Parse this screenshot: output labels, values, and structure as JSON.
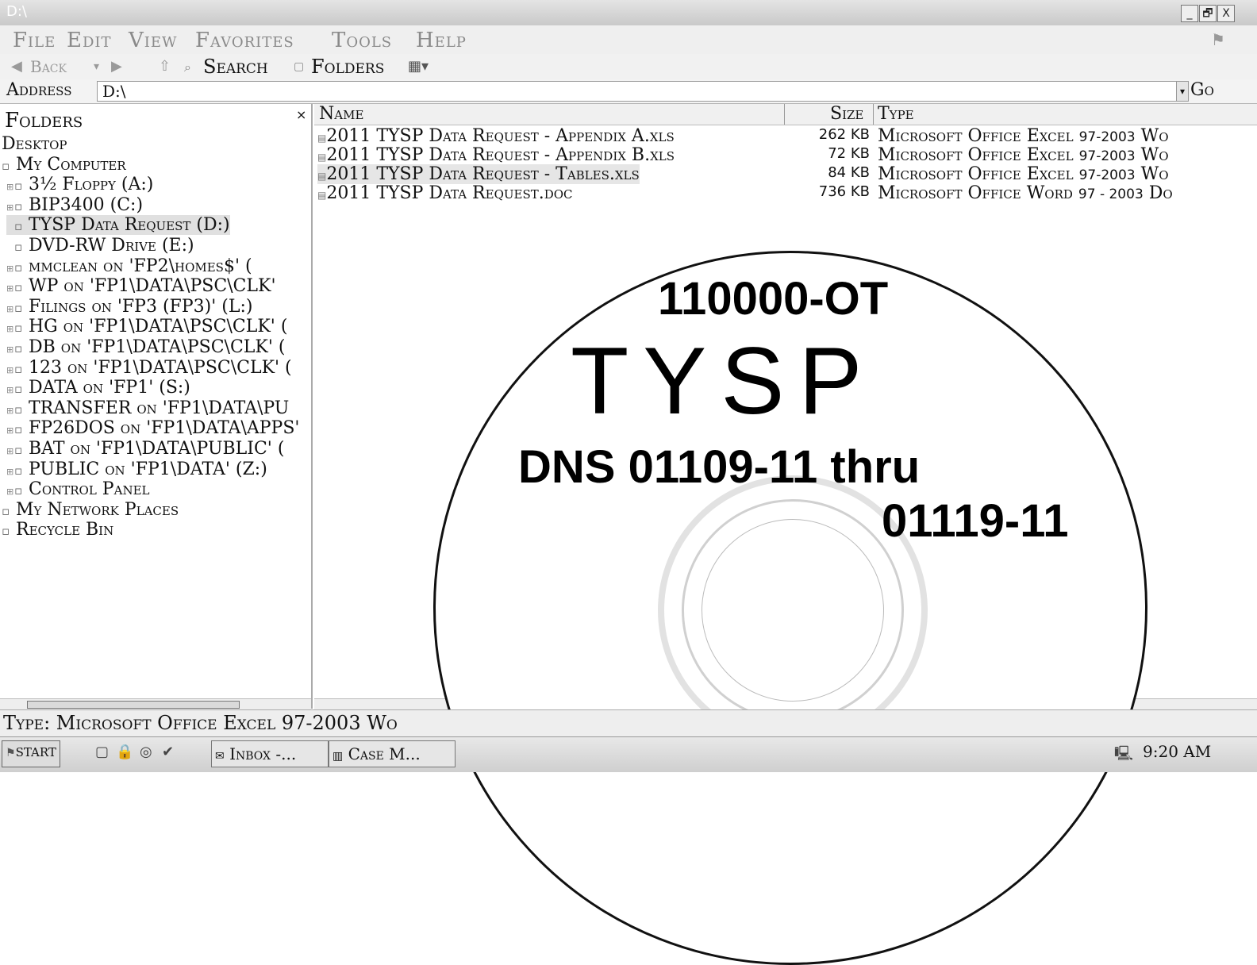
{
  "window": {
    "title": "D:\\",
    "controls": {
      "minimize": "_",
      "restore": "🗗",
      "close": "X"
    }
  },
  "menu": {
    "items": [
      "File",
      "Edit",
      "View",
      "Favorites",
      "Tools",
      "Help"
    ]
  },
  "toolbar": {
    "back_label": "Back",
    "search_label": "Search",
    "folders_label": "Folders"
  },
  "address": {
    "label": "Address",
    "value": "D:\\",
    "go_label": "Go"
  },
  "folders_pane": {
    "title": "Folders",
    "close": "×",
    "items": [
      {
        "label": "Desktop",
        "icon": "desktop-icon"
      },
      {
        "label": "My Computer",
        "icon": "computer-icon"
      },
      {
        "label": "3½ Floppy (A:)",
        "icon": "floppy-icon"
      },
      {
        "label": "BIP3400 (C:)",
        "icon": "hard-drive-icon"
      },
      {
        "label": "TYSP Data Request (D:)",
        "icon": "cd-drive-icon"
      },
      {
        "label": "DVD-RW Drive (E:)",
        "icon": "dvd-drive-icon"
      },
      {
        "label": "mmclean on 'FP2\\homes$' (",
        "icon": "network-drive-icon"
      },
      {
        "label": "WP on 'FP1\\DATA\\PSC\\CLK' ",
        "icon": "network-drive-icon"
      },
      {
        "label": "Filings on 'FP3 (FP3)' (L:)",
        "icon": "network-drive-icon"
      },
      {
        "label": "HG on 'FP1\\DATA\\PSC\\CLK' (",
        "icon": "network-drive-icon"
      },
      {
        "label": "DB on 'FP1\\DATA\\PSC\\CLK' (",
        "icon": "network-drive-icon"
      },
      {
        "label": "123 on 'FP1\\DATA\\PSC\\CLK' (",
        "icon": "network-drive-icon"
      },
      {
        "label": "DATA on 'FP1' (S:)",
        "icon": "network-drive-icon"
      },
      {
        "label": "TRANSFER on 'FP1\\DATA\\PU",
        "icon": "network-drive-icon"
      },
      {
        "label": "FP26DOS on 'FP1\\DATA\\APPS'",
        "icon": "network-drive-icon"
      },
      {
        "label": "BAT on 'FP1\\DATA\\PUBLIC' (",
        "icon": "network-drive-icon"
      },
      {
        "label": "PUBLIC on 'FP1\\DATA' (Z:)",
        "icon": "network-drive-icon"
      },
      {
        "label": "Control Panel",
        "icon": "control-panel-icon"
      },
      {
        "label": "My Network Places",
        "icon": "network-places-icon"
      },
      {
        "label": "Recycle Bin",
        "icon": "recycle-bin-icon"
      }
    ]
  },
  "file_list": {
    "columns": {
      "name": "Name",
      "size": "Size",
      "type": "Type"
    },
    "rows": [
      {
        "name": "2011 TYSP Data Request - Appendix A.xls",
        "size": "262 KB",
        "type_prefix": "Microsoft Office Excel ",
        "type_num": "97-2003",
        "type_suffix": " Wo"
      },
      {
        "name": "2011 TYSP Data Request - Appendix B.xls",
        "size": "72 KB",
        "type_prefix": "Microsoft Office Excel ",
        "type_num": "97-2003",
        "type_suffix": " Wo"
      },
      {
        "name": "2011 TYSP Data Request - Tables.xls",
        "size": "84 KB",
        "type_prefix": "Microsoft Office Excel ",
        "type_num": "97-2003",
        "type_suffix": " Wo"
      },
      {
        "name": "2011 TYSP Data Request.doc",
        "size": "736 KB",
        "type_prefix": "Microsoft Office Word ",
        "type_num": "97 - 2003",
        "type_suffix": " Do"
      }
    ]
  },
  "status": {
    "text": "Type: Microsoft Office Excel 97-2003 Wo"
  },
  "taskbar": {
    "start_label": "start",
    "tasks": [
      "Inbox -...",
      "Case M..."
    ],
    "clock": "9:20 AM"
  },
  "cd_label": {
    "line1": "110000-OT",
    "line2": "TYSP",
    "line3": "DNS 01109-11 thru",
    "line4": "01119-11"
  }
}
